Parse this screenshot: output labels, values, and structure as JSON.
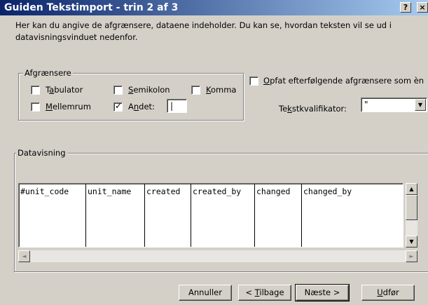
{
  "window": {
    "title": "Guiden Tekstimport - trin 2 af 3",
    "help_button": "?",
    "close_button": "×"
  },
  "intro_text": "Her kan du angive de afgrænsere, dataene indeholder. Du kan se, hvordan teksten vil se ud i datavisningsvinduet nedenfor.",
  "delimiters": {
    "group_label": "Afgrænsere",
    "tab": {
      "label_pre": "T",
      "label_u": "a",
      "label_post": "bulator",
      "checked": false
    },
    "semicolon": {
      "label_pre": "",
      "label_u": "S",
      "label_post": "emikolon",
      "checked": false
    },
    "comma": {
      "label_pre": "",
      "label_u": "K",
      "label_post": "omma",
      "checked": false
    },
    "space": {
      "label_pre": "",
      "label_u": "M",
      "label_post": "ellemrum",
      "checked": false
    },
    "other": {
      "label_pre": "A",
      "label_u": "n",
      "label_post": "det:",
      "checked": true,
      "value": "|"
    }
  },
  "consecutive": {
    "label_pre": "",
    "label_u": "O",
    "label_post": "pfat efterfølgende afgrænsere som èn",
    "checked": false
  },
  "qualifier": {
    "label_pre": "Te",
    "label_u": "k",
    "label_post": "stkvalifikator:",
    "value": "\""
  },
  "preview": {
    "group_label": "Datavisning",
    "columns": [
      "#unit_code",
      "unit_name",
      "created",
      "created_by",
      "changed",
      "changed_by"
    ]
  },
  "buttons": {
    "cancel": {
      "pre": "Annuller",
      "u": "",
      "post": ""
    },
    "back": {
      "pre": "< ",
      "u": "T",
      "post": "ilbage"
    },
    "next": {
      "pre": "Næste >",
      "u": "",
      "post": ""
    },
    "finish": {
      "pre": "",
      "u": "U",
      "post": "dfør"
    }
  },
  "icons": {
    "check": "✓",
    "arrow_down": "▼",
    "arrow_up": "▲",
    "arrow_left": "◄",
    "arrow_right": "►"
  }
}
